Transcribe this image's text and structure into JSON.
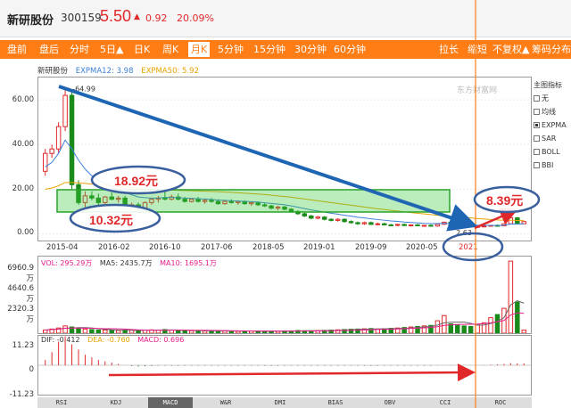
{
  "header": {
    "stock_name": "新研股份",
    "stock_code": "300159",
    "price": "5.50",
    "change_arrow": "▲",
    "change": "0.92",
    "change_pct": "20.09%"
  },
  "toolbar": {
    "left_items": [
      "盘前",
      "盘后",
      "分时",
      "5日▲",
      "日K",
      "周K",
      "月K",
      "5分钟",
      "15分钟",
      "30分钟",
      "60分钟"
    ],
    "active": "月K",
    "right_items": [
      "拉长",
      "缩短",
      "不复权▲",
      "筹码分布"
    ]
  },
  "legend": {
    "stock": "新研股份",
    "ema12": "EXPMA12: 3.98",
    "ema50": "EXPMA50: 5.92"
  },
  "side_panel": {
    "title": "主图指标",
    "items": [
      {
        "label": "无",
        "checked": false
      },
      {
        "label": "均线",
        "checked": false
      },
      {
        "label": "EXPMA",
        "checked": true
      },
      {
        "label": "SAR",
        "checked": false
      },
      {
        "label": "BOLL",
        "checked": false
      },
      {
        "label": "BBI",
        "checked": false
      }
    ]
  },
  "watermark": "东方财富网",
  "volume_legend": {
    "vol": "VOL: 295.29万",
    "ma5": "MA5: 2435.7万",
    "ma10": "MA10: 1695.1万"
  },
  "macd_legend": {
    "dif": "DIF: -0.412",
    "dea": "DEA: -0.760",
    "macd": "MACD: 0.696"
  },
  "indicator_tabs": {
    "items": [
      "RSI",
      "KDJ",
      "MACD",
      "W&R",
      "DMI",
      "BIAS",
      "OBV",
      "CCI",
      "ROC"
    ],
    "active": "MACD"
  },
  "annotations": {
    "high_label": "18.92元",
    "low_label": "10.32元",
    "recent_label": "8.39元",
    "bottom_marker": "2021"
  },
  "chart_data": {
    "type": "candlestick",
    "title": "",
    "price_axis": {
      "ticks": [
        "60.00",
        "40.00",
        "20.00",
        "0.00"
      ],
      "ylim": [
        -3,
        70
      ]
    },
    "x_axis": {
      "ticks": [
        "2015-04",
        "2016-02",
        "2016-10",
        "2017-06",
        "2018-05",
        "2019-01",
        "2019-09",
        "2020-05",
        "2021"
      ]
    },
    "peak_label": "64.99",
    "trough_label": "2.63",
    "candles": [
      {
        "o": 28.0,
        "h": 38.0,
        "l": 26.0,
        "c": 36.0
      },
      {
        "o": 36.0,
        "h": 40.0,
        "l": 34.0,
        "c": 38.0
      },
      {
        "o": 38.0,
        "h": 50.0,
        "l": 36.0,
        "c": 48.0
      },
      {
        "o": 48.0,
        "h": 64.99,
        "l": 46.0,
        "c": 62.0
      },
      {
        "o": 62.0,
        "h": 64.0,
        "l": 20.0,
        "c": 22.0
      },
      {
        "o": 22.0,
        "h": 24.0,
        "l": 13.0,
        "c": 14.0
      },
      {
        "o": 14.0,
        "h": 19.0,
        "l": 12.0,
        "c": 17.0
      },
      {
        "o": 17.0,
        "h": 19.0,
        "l": 15.0,
        "c": 16.0
      },
      {
        "o": 16.0,
        "h": 18.0,
        "l": 13.0,
        "c": 14.0
      },
      {
        "o": 14.0,
        "h": 17.0,
        "l": 13.0,
        "c": 16.5
      },
      {
        "o": 16.5,
        "h": 18.5,
        "l": 15.0,
        "c": 15.5
      },
      {
        "o": 15.5,
        "h": 17.0,
        "l": 14.0,
        "c": 16.0
      },
      {
        "o": 16.0,
        "h": 17.0,
        "l": 12.0,
        "c": 12.5
      },
      {
        "o": 12.5,
        "h": 14.0,
        "l": 11.0,
        "c": 13.0
      },
      {
        "o": 13.0,
        "h": 14.0,
        "l": 10.32,
        "c": 11.5
      },
      {
        "o": 11.5,
        "h": 14.5,
        "l": 11.0,
        "c": 14.0
      },
      {
        "o": 14.0,
        "h": 16.0,
        "l": 13.0,
        "c": 15.5
      },
      {
        "o": 15.5,
        "h": 17.0,
        "l": 14.0,
        "c": 16.0
      },
      {
        "o": 16.0,
        "h": 18.92,
        "l": 15.0,
        "c": 15.5
      },
      {
        "o": 15.5,
        "h": 17.5,
        "l": 15.0,
        "c": 16.5
      },
      {
        "o": 16.5,
        "h": 18.0,
        "l": 15.0,
        "c": 15.5
      },
      {
        "o": 15.5,
        "h": 16.5,
        "l": 14.0,
        "c": 14.5
      },
      {
        "o": 14.5,
        "h": 16.0,
        "l": 14.0,
        "c": 15.5
      },
      {
        "o": 15.5,
        "h": 16.5,
        "l": 14.0,
        "c": 14.5
      },
      {
        "o": 14.5,
        "h": 15.5,
        "l": 13.5,
        "c": 15.0
      },
      {
        "o": 15.0,
        "h": 16.0,
        "l": 14.0,
        "c": 14.5
      },
      {
        "o": 14.5,
        "h": 15.5,
        "l": 13.0,
        "c": 13.5
      },
      {
        "o": 13.5,
        "h": 15.0,
        "l": 13.0,
        "c": 14.5
      },
      {
        "o": 14.5,
        "h": 15.5,
        "l": 13.5,
        "c": 14.0
      },
      {
        "o": 14.0,
        "h": 15.0,
        "l": 13.0,
        "c": 14.5
      },
      {
        "o": 14.5,
        "h": 15.0,
        "l": 13.0,
        "c": 13.5
      },
      {
        "o": 13.5,
        "h": 14.5,
        "l": 12.5,
        "c": 14.0
      },
      {
        "o": 14.0,
        "h": 14.5,
        "l": 12.5,
        "c": 13.0
      },
      {
        "o": 13.0,
        "h": 14.0,
        "l": 12.0,
        "c": 12.5
      },
      {
        "o": 12.5,
        "h": 13.0,
        "l": 11.0,
        "c": 11.5
      },
      {
        "o": 11.5,
        "h": 12.5,
        "l": 10.5,
        "c": 12.0
      },
      {
        "o": 12.0,
        "h": 12.5,
        "l": 10.5,
        "c": 11.0
      },
      {
        "o": 11.0,
        "h": 11.5,
        "l": 9.5,
        "c": 10.0
      },
      {
        "o": 10.0,
        "h": 10.5,
        "l": 8.5,
        "c": 9.0
      },
      {
        "o": 9.0,
        "h": 9.5,
        "l": 7.5,
        "c": 8.0
      },
      {
        "o": 8.0,
        "h": 8.5,
        "l": 6.5,
        "c": 7.0
      },
      {
        "o": 7.0,
        "h": 8.0,
        "l": 6.5,
        "c": 7.5
      },
      {
        "o": 7.5,
        "h": 8.0,
        "l": 6.0,
        "c": 6.5
      },
      {
        "o": 6.5,
        "h": 7.0,
        "l": 5.5,
        "c": 6.0
      },
      {
        "o": 6.0,
        "h": 7.0,
        "l": 5.5,
        "c": 6.5
      },
      {
        "o": 6.5,
        "h": 7.0,
        "l": 5.0,
        "c": 5.5
      },
      {
        "o": 5.5,
        "h": 6.0,
        "l": 4.5,
        "c": 5.0
      },
      {
        "o": 5.0,
        "h": 5.5,
        "l": 4.0,
        "c": 4.5
      },
      {
        "o": 4.5,
        "h": 5.5,
        "l": 4.0,
        "c": 5.0
      },
      {
        "o": 5.0,
        "h": 5.5,
        "l": 4.0,
        "c": 4.2
      },
      {
        "o": 4.2,
        "h": 5.0,
        "l": 3.8,
        "c": 4.5
      },
      {
        "o": 4.5,
        "h": 5.0,
        "l": 3.8,
        "c": 4.0
      },
      {
        "o": 4.0,
        "h": 4.5,
        "l": 3.5,
        "c": 3.8
      },
      {
        "o": 3.8,
        "h": 4.5,
        "l": 3.4,
        "c": 4.2
      },
      {
        "o": 4.2,
        "h": 4.6,
        "l": 3.5,
        "c": 3.7
      },
      {
        "o": 3.7,
        "h": 4.2,
        "l": 3.3,
        "c": 4.0
      },
      {
        "o": 4.0,
        "h": 4.4,
        "l": 3.4,
        "c": 3.6
      },
      {
        "o": 3.6,
        "h": 4.0,
        "l": 3.2,
        "c": 3.8
      },
      {
        "o": 3.8,
        "h": 4.2,
        "l": 3.3,
        "c": 3.5
      },
      {
        "o": 3.5,
        "h": 4.5,
        "l": 3.2,
        "c": 4.3
      },
      {
        "o": 4.3,
        "h": 5.5,
        "l": 4.0,
        "c": 5.2
      },
      {
        "o": 5.2,
        "h": 5.8,
        "l": 4.2,
        "c": 4.5
      },
      {
        "o": 4.5,
        "h": 5.0,
        "l": 3.8,
        "c": 4.0
      },
      {
        "o": 4.0,
        "h": 4.5,
        "l": 3.3,
        "c": 3.5
      },
      {
        "o": 3.5,
        "h": 3.8,
        "l": 2.9,
        "c": 3.1
      },
      {
        "o": 3.1,
        "h": 3.5,
        "l": 2.63,
        "c": 3.3
      },
      {
        "o": 3.3,
        "h": 3.8,
        "l": 3.0,
        "c": 3.5
      },
      {
        "o": 3.5,
        "h": 4.0,
        "l": 3.2,
        "c": 3.8
      },
      {
        "o": 3.8,
        "h": 4.2,
        "l": 3.3,
        "c": 3.6
      },
      {
        "o": 3.6,
        "h": 4.6,
        "l": 3.4,
        "c": 4.5
      },
      {
        "o": 4.5,
        "h": 8.39,
        "l": 4.2,
        "c": 7.2
      },
      {
        "o": 7.2,
        "h": 7.5,
        "l": 4.5,
        "c": 4.8
      },
      {
        "o": 4.5,
        "h": 5.5,
        "l": 4.4,
        "c": 5.5
      }
    ],
    "ema12": [
      30,
      32,
      36,
      42,
      38,
      33,
      29,
      26,
      24,
      22.5,
      21,
      20,
      18.5,
      17.5,
      16.5,
      16.2,
      16,
      16,
      16.3,
      16.3,
      16.2,
      16,
      15.9,
      15.7,
      15.6,
      15.4,
      15.1,
      15,
      14.8,
      14.7,
      14.5,
      14.4,
      14.2,
      13.9,
      13.6,
      13.3,
      13,
      12.5,
      11.9,
      11.3,
      10.7,
      10.2,
      9.7,
      9.2,
      8.8,
      8.3,
      7.9,
      7.4,
      7.1,
      6.7,
      6.4,
      6.1,
      5.8,
      5.6,
      5.3,
      5.1,
      4.9,
      4.7,
      4.6,
      4.6,
      4.7,
      4.6,
      4.5,
      4.3,
      4.1,
      3.9,
      3.8,
      3.8,
      3.7,
      3.9,
      4.4,
      4.4,
      4.5
    ],
    "ema50": [
      20,
      20.5,
      21.5,
      23,
      23,
      22.8,
      22.6,
      22.3,
      22,
      21.8,
      21.5,
      21.2,
      20.9,
      20.6,
      20.3,
      20.1,
      19.9,
      19.8,
      19.7,
      19.6,
      19.5,
      19.4,
      19.3,
      19.2,
      19.1,
      19,
      18.9,
      18.7,
      18.6,
      18.4,
      18.2,
      18,
      17.8,
      17.6,
      17.3,
      17,
      16.7,
      16.4,
      16,
      15.6,
      15.2,
      14.8,
      14.4,
      14,
      13.6,
      13.2,
      12.8,
      12.4,
      12,
      11.6,
      11.2,
      10.9,
      10.5,
      10.2,
      9.8,
      9.5,
      9.2,
      8.9,
      8.6,
      8.3,
      8.1,
      7.8,
      7.6,
      7.3,
      7.1,
      6.8,
      6.6,
      6.4,
      6.2,
      6.1,
      6.1,
      6,
      5.92
    ],
    "volume": {
      "ticks": [
        "6960.9万",
        "4640.6万",
        "2320.3万"
      ],
      "ylim": [
        0,
        7400
      ],
      "values": [
        300,
        400,
        500,
        700,
        600,
        500,
        400,
        350,
        300,
        300,
        280,
        260,
        300,
        280,
        250,
        300,
        320,
        300,
        350,
        300,
        260,
        250,
        240,
        230,
        220,
        210,
        230,
        210,
        200,
        190,
        200,
        210,
        190,
        180,
        200,
        190,
        210,
        220,
        260,
        240,
        230,
        250,
        270,
        300,
        320,
        350,
        380,
        400,
        420,
        450,
        400,
        430,
        470,
        500,
        550,
        600,
        650,
        700,
        750,
        1200,
        1700,
        900,
        800,
        700,
        650,
        800,
        1000,
        1500,
        1800,
        2400,
        6960,
        3000,
        295
      ]
    },
    "macd": {
      "ticks": [
        "11.23",
        "0",
        "-11.23"
      ],
      "ylim": [
        -11.23,
        11.23
      ],
      "hist": [
        2,
        5,
        9,
        11,
        8,
        6,
        4,
        3,
        2,
        1.5,
        1,
        0.5,
        0,
        -0.3,
        -0.5,
        -0.4,
        -0.3,
        -0.2,
        -0.2,
        -0.2,
        -0.2,
        -0.2,
        -0.2,
        -0.2,
        -0.2,
        -0.2,
        -0.2,
        -0.2,
        -0.2,
        -0.2,
        -0.2,
        -0.2,
        -0.2,
        -0.2,
        -0.2,
        -0.2,
        -0.2,
        -0.2,
        -0.2,
        -0.2,
        -0.2,
        -0.2,
        -0.2,
        -0.2,
        -0.2,
        -0.2,
        -0.2,
        -0.2,
        -0.2,
        -0.2,
        -0.2,
        -0.2,
        -0.2,
        -0.2,
        -0.2,
        -0.2,
        -0.2,
        -0.2,
        -0.2,
        -0.1,
        0,
        0.1,
        0.1,
        0,
        0,
        0,
        0.1,
        0.2,
        0.3,
        0.5,
        0.8,
        0.7,
        0.696
      ]
    }
  }
}
